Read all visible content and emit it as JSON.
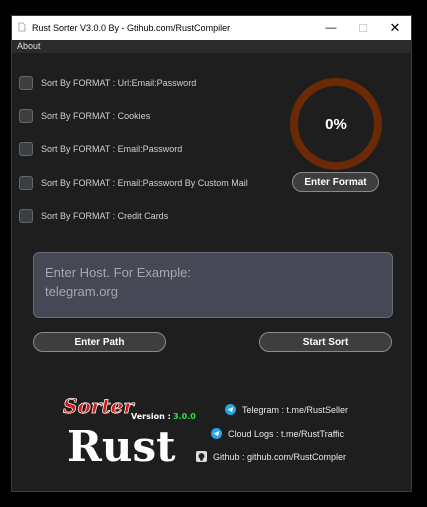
{
  "window": {
    "title": "Rust Sorter V3.0.0 By - Gtihub.com/RustCompiler",
    "minimize_glyph": "—",
    "maximize_glyph": "☐",
    "close_glyph": "✕"
  },
  "menu": {
    "about": "About"
  },
  "options": [
    {
      "label": "Sort By FORMAT : Url:Email:Password",
      "checked": false
    },
    {
      "label": "Sort By FORMAT : Cookies",
      "checked": false
    },
    {
      "label": "Sort By FORMAT : Email:Password",
      "checked": false
    },
    {
      "label": "Sort By FORMAT : Email:Password By Custom Mail",
      "checked": false
    },
    {
      "label": "Sort By FORMAT : Credit Cards",
      "checked": false
    }
  ],
  "progress": {
    "value": 0,
    "label": "0%"
  },
  "buttons": {
    "enter_format": "Enter Format",
    "enter_path": "Enter Path",
    "start_sort": "Start Sort"
  },
  "host_input": {
    "placeholder": "Enter Host. For Example:\ntelegram.org",
    "value": ""
  },
  "logo": {
    "sorter": "Sorter",
    "rust": "Rust",
    "version_label": "Version :",
    "version": "3.0.0"
  },
  "links": {
    "telegram": "Telegram : t.me/RustSeller",
    "cloud_logs": "Cloud Logs : t.me/RustTraffic",
    "github": "Github : github.com/RustCompler"
  },
  "colors": {
    "ring": "#6b2a05",
    "sorter_red": "#d01818",
    "version_green": "#2ee04a",
    "telegram_blue": "#2aa3e0"
  }
}
